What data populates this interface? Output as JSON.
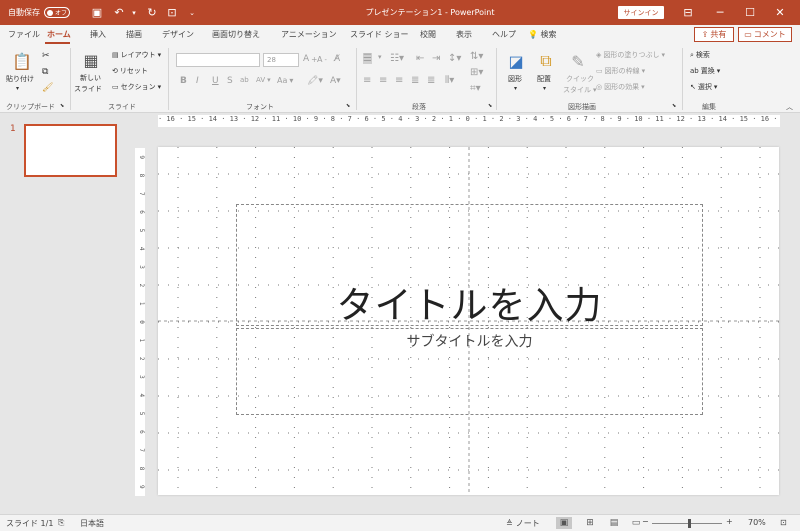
{
  "titlebar": {
    "autosave_label": "自動保存",
    "autosave_state": "オフ",
    "title": "プレゼンテーション1 - PowerPoint",
    "signin": "サインイン"
  },
  "tabs": [
    "ファイル",
    "ホーム",
    "挿入",
    "描画",
    "デザイン",
    "画面切り替え",
    "アニメーション",
    "スライド ショー",
    "校閲",
    "表示",
    "ヘルプ",
    "検索"
  ],
  "share": "共有",
  "comment": "コメント",
  "ribbon": {
    "clipboard": {
      "label": "クリップボード",
      "paste": "貼り付け"
    },
    "slides": {
      "label": "スライド",
      "new_slide_line1": "新しい",
      "new_slide_line2": "スライド",
      "layout": "レイアウト",
      "reset": "リセット",
      "section": "セクション"
    },
    "font": {
      "label": "フォント",
      "font_name": "",
      "font_size": "28",
      "bold": "B",
      "italic": "I",
      "underline": "U",
      "strike": "S",
      "shadow": "ab",
      "spacing": "AV",
      "case": "Aa",
      "grow": "A",
      "shrink": "A"
    },
    "paragraph": {
      "label": "段落"
    },
    "drawing": {
      "label": "図形描画",
      "shapes": "図形",
      "arrange": "配置",
      "quick_styles_1": "クイック",
      "quick_styles_2": "スタイル",
      "fill": "図形の塗りつぶし",
      "outline": "図形の枠線",
      "effects": "図形の効果"
    },
    "editing": {
      "label": "編集",
      "find": "検索",
      "replace": "置換",
      "select": "選択"
    }
  },
  "slide_panel": {
    "slide_number": "1"
  },
  "ruler": {
    "horizontal": "· 16 · 15 · 14 · 13 · 12 · 11 · 10 · 9 · 8 · 7 · 6 · 5 · 4 · 3 · 2 · 1 · 0 · 1 · 2 · 3 · 4 · 5 · 6 · 7 · 8 · 9 · 10 · 11 · 12 · 13 · 14 · 15 · 16 ·",
    "vertical": [
      "9",
      "8",
      "7",
      "6",
      "5",
      "4",
      "3",
      "2",
      "1",
      "0",
      "1",
      "2",
      "3",
      "4",
      "5",
      "6",
      "7",
      "8",
      "9"
    ]
  },
  "slide": {
    "title_placeholder": "タイトルを入力",
    "subtitle_placeholder": "サブタイトルを入力"
  },
  "statusbar": {
    "slide_info": "スライド 1/1",
    "language": "日本語",
    "notes": "ノート",
    "zoom": "70%"
  },
  "colors": {
    "accent": "#b7472a",
    "ribbon_bg": "#f3f3f3",
    "workspace_bg": "#e6e6e6"
  }
}
